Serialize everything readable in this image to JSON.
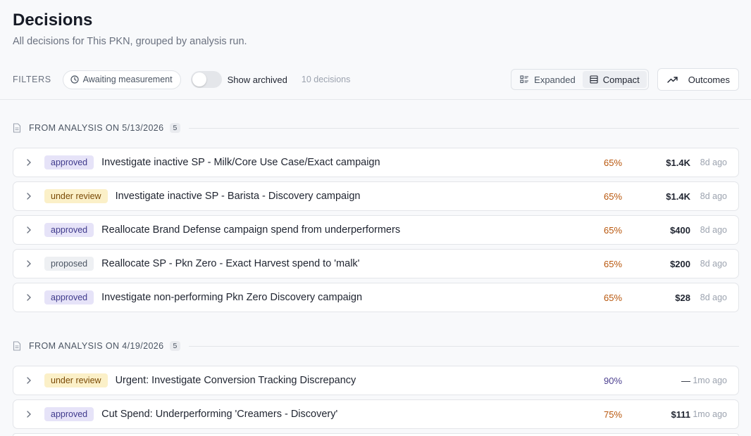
{
  "page": {
    "title": "Decisions",
    "subtitle": "All decisions for This PKN, grouped by analysis run."
  },
  "filters": {
    "label": "FILTERS",
    "awaiting_chip": "Awaiting measurement",
    "show_archived": "Show archived",
    "show_archived_on": false,
    "count": "10 decisions"
  },
  "view": {
    "expanded": "Expanded",
    "compact": "Compact",
    "active": "compact",
    "outcomes": "Outcomes"
  },
  "colors": {
    "confidence_orange": "#b8560c",
    "confidence_purple": "#4b3f8f"
  },
  "groups": [
    {
      "title": "FROM ANALYSIS ON 5/13/2026",
      "count": "5",
      "rows": [
        {
          "status": "approved",
          "title": "Investigate inactive SP - Milk/Core Use Case/Exact campaign",
          "confidence": "65%",
          "amount": "$1.4K",
          "ago": "8d ago"
        },
        {
          "status": "under review",
          "title": "Investigate inactive SP - Barista - Discovery campaign",
          "confidence": "65%",
          "amount": "$1.4K",
          "ago": "8d ago"
        },
        {
          "status": "approved",
          "title": "Reallocate Brand Defense campaign spend from underperformers",
          "confidence": "65%",
          "amount": "$400",
          "ago": "8d ago"
        },
        {
          "status": "proposed",
          "title": "Reallocate SP - Pkn Zero - Exact Harvest spend to 'malk'",
          "confidence": "65%",
          "amount": "$200",
          "ago": "8d ago"
        },
        {
          "status": "approved",
          "title": "Investigate non-performing Pkn Zero Discovery campaign",
          "confidence": "65%",
          "amount": "$28",
          "ago": "8d ago"
        }
      ]
    },
    {
      "title": "FROM ANALYSIS ON 4/19/2026",
      "count": "5",
      "rows": [
        {
          "status": "under review",
          "title": "Urgent: Investigate Conversion Tracking Discrepancy",
          "confidence": "90%",
          "amount": "—",
          "ago": "1mo ago"
        },
        {
          "status": "approved",
          "title": "Cut Spend: Underperforming 'Creamers - Discovery'",
          "confidence": "75%",
          "amount": "$111",
          "ago": "1mo ago"
        }
      ]
    }
  ]
}
